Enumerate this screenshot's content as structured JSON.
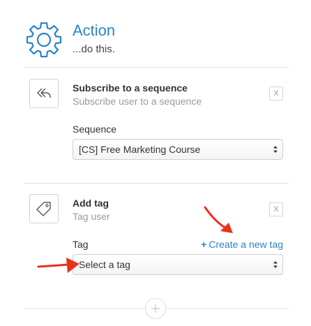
{
  "header": {
    "title": "Action",
    "subtitle": "...do this.",
    "icon": "gear-icon"
  },
  "actions": [
    {
      "title": "Subscribe to a sequence",
      "subtitle": "Subscribe user to a sequence",
      "icon": "reply-all-icon",
      "close_label": "X",
      "field_label": "Sequence",
      "select_value": "[CS] Free Marketing Course"
    },
    {
      "title": "Add tag",
      "subtitle": "Tag user",
      "icon": "tag-icon",
      "close_label": "X",
      "field_label": "Tag",
      "create_link": "Create a new tag",
      "create_link_icon": "+",
      "select_value": "Select a tag"
    }
  ],
  "add_action_icon": "plus-icon",
  "colors": {
    "accent": "#2a84c6",
    "annotation_arrow": "#e8321e"
  }
}
